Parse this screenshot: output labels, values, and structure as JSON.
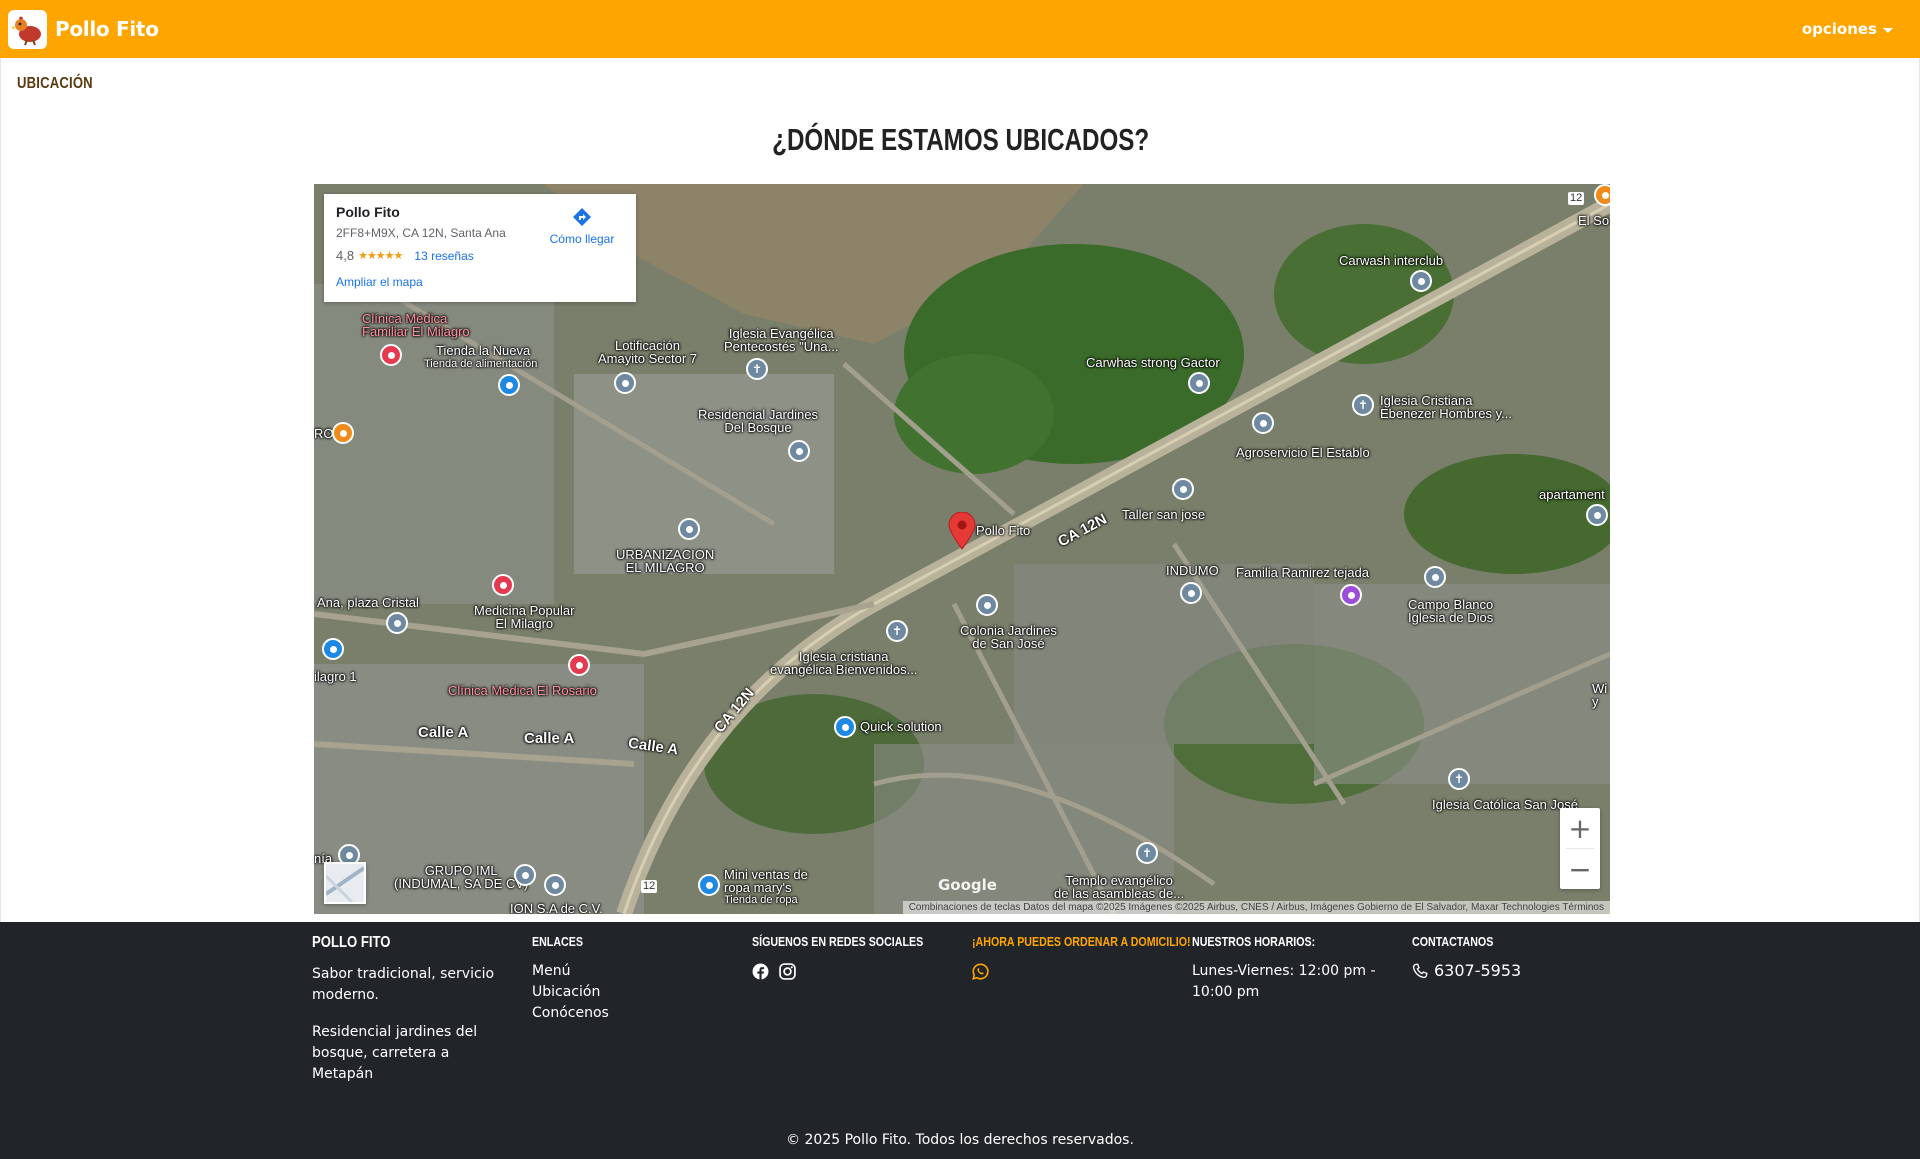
{
  "navbar": {
    "brand_name": "Pollo Fito",
    "options_label": "opciones"
  },
  "breadcrumb": "UBICACIÓN",
  "page_title": "¿DÓNDE ESTAMOS UBICADOS?",
  "map": {
    "info": {
      "name": "Pollo Fito",
      "address": "2FF8+M9X, CA 12N, Santa Ana",
      "rating": "4,8",
      "stars": "★★★★★",
      "reviews": "13 reseñas",
      "directions": "Cómo llegar",
      "enlarge": "Ampliar el mapa"
    },
    "labels": {
      "clinica_milagro": "Clínica Médica\nFamiliar El Milagro",
      "tienda_nueva": "Tienda la Nueva",
      "tienda_alimentacion": "Tienda de alimentación",
      "lotificacion": "Lotificación\nAmayito Sector 7",
      "iglesia_pentecostes": "Iglesia Evangélica\nPentecostés \"Una...",
      "residencial": "Residencial Jardines\nDel Bosque",
      "carwash_interclub": "Carwash interclub",
      "carwhas_gactor": "Carwhas strong Gactor",
      "iglesia_ebenezer": "Iglesia Cristiana\nEbenezer Hombres y...",
      "agroservicio": "Agroservicio El Establo",
      "taller": "Taller san jose",
      "pollo_fito": "Pollo Fito",
      "road_ca12n": "CA 12N",
      "road_ca12n_2": "CA 12N",
      "urbanizacion": "URBANIZACION\nEL MILAGRO",
      "indumo": "INDUMO",
      "familia_ramirez": "Familia Ramirez tejada",
      "campo_blanco": "Campo Blanco\nIglesia de Dios",
      "apartamentos": "apartament",
      "el_so": "El So",
      "plaza_cristal": "Ana, plaza Cristal",
      "medicina_popular": "Medicina Popular\nEl Milagro",
      "colonia_jardines": "Colonia Jardines\nde San José",
      "iglesia_bienvenidos": "Iglesia cristiana\nevangélica Bienvenidos...",
      "milagro_1": "ilagro 1",
      "clinica_rosario": "Clínica Médica El Rosario",
      "calle_a_1": "Calle A",
      "calle_a_2": "Calle A",
      "calle_a_3": "Calle A",
      "quick_solution": "Quick solution",
      "iglesia_catolica": "Iglesia Católica San José",
      "grupo_iml": "GRUPO IML\n(INDUMAL, SA DE CV)",
      "mini_ventas": "Mini ventas de\nropa mary's",
      "tienda_ropa": "Tienda de ropa",
      "templo": "Templo evangélico\nde las asambleas de...",
      "ion": "ION S.A de C.V.",
      "wi": "Wi\ny",
      "ro": "RO",
      "nia": "nía",
      "shield": "12",
      "shield_2": "12"
    },
    "google": "Google",
    "attribution": "Combinaciones de teclas   Datos del mapa ©2025 Imágenes ©2025 Airbus, CNES / Airbus, Imágenes Gobierno de El Salvador, Maxar Technologies   Términos",
    "zoom_in": "+",
    "zoom_out": "−"
  },
  "footer": {
    "brand": {
      "title": "POLLO FITO",
      "tagline": "Sabor tradicional, servicio moderno.",
      "address": "Residencial jardines del bosque, carretera a Metapán"
    },
    "links": {
      "title": "ENLACES",
      "items": [
        "Menú",
        "Ubicación",
        "Conócenos"
      ]
    },
    "social": {
      "title": "SÍGUENOS EN REDES SOCIALES"
    },
    "order": {
      "title": "¡AHORA PUEDES ORDENAR A DOMICILIO!"
    },
    "hours": {
      "title": "NUESTROS HORARIOS:",
      "text": "Lunes-Viernes: 12:00 pm - 10:00 pm"
    },
    "contact": {
      "title": "CONTACTANOS",
      "phone": "6307-5953"
    },
    "copyright": "© 2025 Pollo Fito. Todos los derechos reservados."
  },
  "colors": {
    "brand_orange": "#ffa500",
    "footer_bg": "#212529",
    "map_pin_red": "#e53935",
    "link_blue": "#1a73e8"
  },
  "icons": [
    "chicken-logo-icon",
    "caret-down-icon",
    "directions-icon",
    "map-pin-icon",
    "facebook-icon",
    "instagram-icon",
    "whatsapp-icon",
    "phone-icon"
  ]
}
